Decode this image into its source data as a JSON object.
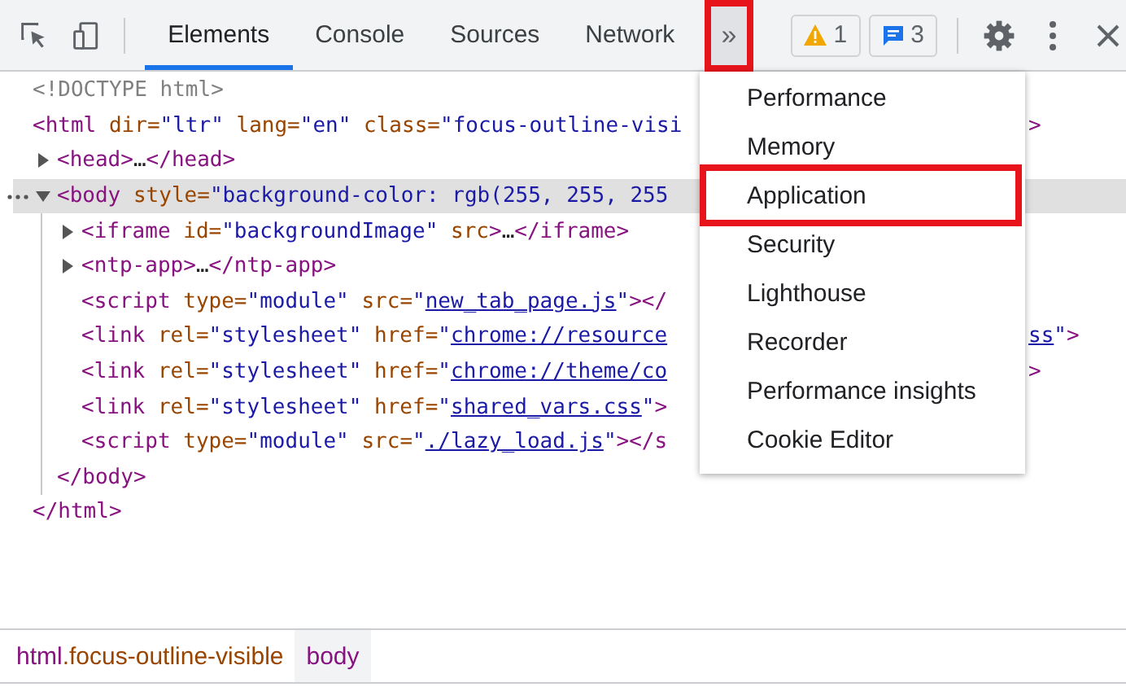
{
  "tabs": [
    {
      "label": "Elements",
      "selected": true
    },
    {
      "label": "Console",
      "selected": false
    },
    {
      "label": "Sources",
      "selected": false
    },
    {
      "label": "Network",
      "selected": false
    }
  ],
  "overflow_button": {
    "label": "»",
    "highlighted": true
  },
  "issues": [
    {
      "kind": "warning",
      "count": "1"
    },
    {
      "kind": "message",
      "count": "3"
    }
  ],
  "dom": [
    {
      "tokens": [
        {
          "kind": "doctype",
          "text": "<!DOCTYPE html>"
        }
      ],
      "selected": false
    },
    {
      "tokens": [
        {
          "kind": "tag",
          "text": "<html"
        },
        {
          "kind": "attr",
          "text": " dir="
        },
        {
          "kind": "value",
          "text": "\"ltr\""
        },
        {
          "kind": "attr",
          "text": " lang="
        },
        {
          "kind": "value",
          "text": "\"en\""
        },
        {
          "kind": "attr",
          "text": " class="
        },
        {
          "kind": "value",
          "text": "\"focus-outline-visi"
        }
      ],
      "tail": [
        {
          "kind": "tag",
          "text": ">"
        }
      ],
      "selected": false,
      "children": [
        {
          "tokens": [
            {
              "kind": "tag",
              "text": "<head>"
            },
            {
              "kind": "text",
              "text": "…"
            },
            {
              "kind": "tag",
              "text": "</head>"
            }
          ],
          "expanded": false,
          "selected": false
        },
        {
          "tokens": [
            {
              "kind": "tag",
              "text": "<body"
            },
            {
              "kind": "attr",
              "text": " style="
            },
            {
              "kind": "value",
              "text": "\"background-color: rgb(255, 255, 255"
            }
          ],
          "expanded": true,
          "selected": true,
          "children": [
            {
              "tokens": [
                {
                  "kind": "tag",
                  "text": "<iframe"
                },
                {
                  "kind": "attr",
                  "text": " id="
                },
                {
                  "kind": "value",
                  "text": "\"backgroundImage\""
                },
                {
                  "kind": "attr",
                  "text": " src"
                },
                {
                  "kind": "tag",
                  "text": ">"
                },
                {
                  "kind": "text",
                  "text": "…"
                },
                {
                  "kind": "tag",
                  "text": "</iframe>"
                }
              ],
              "expanded": false,
              "selected": false
            },
            {
              "tokens": [
                {
                  "kind": "tag",
                  "text": "<ntp-app>"
                },
                {
                  "kind": "text",
                  "text": "…"
                },
                {
                  "kind": "tag",
                  "text": "</ntp-app>"
                }
              ],
              "expanded": false,
              "selected": false
            },
            {
              "tokens": [
                {
                  "kind": "tag",
                  "text": "<script"
                },
                {
                  "kind": "attr",
                  "text": " type="
                },
                {
                  "kind": "value",
                  "text": "\"module\""
                },
                {
                  "kind": "attr",
                  "text": " src="
                },
                {
                  "kind": "value",
                  "text": "\""
                },
                {
                  "kind": "link",
                  "text": "new_tab_page.js"
                },
                {
                  "kind": "value",
                  "text": "\""
                },
                {
                  "kind": "tag",
                  "text": "></"
                }
              ],
              "selected": false
            },
            {
              "tokens": [
                {
                  "kind": "tag",
                  "text": "<link"
                },
                {
                  "kind": "attr",
                  "text": " rel="
                },
                {
                  "kind": "value",
                  "text": "\"stylesheet\""
                },
                {
                  "kind": "attr",
                  "text": " href="
                },
                {
                  "kind": "value",
                  "text": "\""
                },
                {
                  "kind": "link",
                  "text": "chrome://resource"
                }
              ],
              "tail": [
                {
                  "kind": "link",
                  "text": "ss"
                },
                {
                  "kind": "value",
                  "text": "\""
                },
                {
                  "kind": "tag",
                  "text": ">"
                }
              ],
              "selected": false
            },
            {
              "tokens": [
                {
                  "kind": "tag",
                  "text": "<link"
                },
                {
                  "kind": "attr",
                  "text": " rel="
                },
                {
                  "kind": "value",
                  "text": "\"stylesheet\""
                },
                {
                  "kind": "attr",
                  "text": " href="
                },
                {
                  "kind": "value",
                  "text": "\""
                },
                {
                  "kind": "link",
                  "text": "chrome://theme/co"
                }
              ],
              "tail": [
                {
                  "kind": "tag",
                  "text": ">"
                }
              ],
              "selected": false
            },
            {
              "tokens": [
                {
                  "kind": "tag",
                  "text": "<link"
                },
                {
                  "kind": "attr",
                  "text": " rel="
                },
                {
                  "kind": "value",
                  "text": "\"stylesheet\""
                },
                {
                  "kind": "attr",
                  "text": " href="
                },
                {
                  "kind": "value",
                  "text": "\""
                },
                {
                  "kind": "link",
                  "text": "shared_vars.css"
                },
                {
                  "kind": "value",
                  "text": "\""
                },
                {
                  "kind": "tag",
                  "text": ">"
                }
              ],
              "selected": false
            },
            {
              "tokens": [
                {
                  "kind": "tag",
                  "text": "<script"
                },
                {
                  "kind": "attr",
                  "text": " type="
                },
                {
                  "kind": "value",
                  "text": "\"module\""
                },
                {
                  "kind": "attr",
                  "text": " src="
                },
                {
                  "kind": "value",
                  "text": "\""
                },
                {
                  "kind": "link",
                  "text": "./lazy_load.js"
                },
                {
                  "kind": "value",
                  "text": "\""
                },
                {
                  "kind": "tag",
                  "text": "></s"
                }
              ],
              "selected": false
            }
          ],
          "closing": [
            {
              "kind": "tag",
              "text": "</body>"
            }
          ]
        }
      ],
      "closing": [
        {
          "kind": "tag",
          "text": "</html>"
        }
      ]
    }
  ],
  "menu": {
    "items": [
      {
        "label": "Performance",
        "highlighted": false
      },
      {
        "label": "Memory",
        "highlighted": false
      },
      {
        "label": "Application",
        "highlighted": true
      },
      {
        "label": "Security",
        "highlighted": false
      },
      {
        "label": "Lighthouse",
        "highlighted": false
      },
      {
        "label": "Recorder",
        "highlighted": false
      },
      {
        "label": "Performance insights",
        "highlighted": false
      },
      {
        "label": "Cookie Editor",
        "highlighted": false
      }
    ]
  },
  "breadcrumbs": [
    {
      "tag": "html",
      "class": ".focus-outline-visible",
      "selected": false
    },
    {
      "tag": "body",
      "selected": true
    }
  ]
}
